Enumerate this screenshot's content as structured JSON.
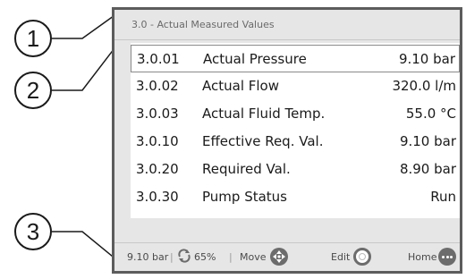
{
  "callouts": [
    "1",
    "2",
    "3"
  ],
  "screen": {
    "title": "3.0 - Actual Measured Values",
    "rows": [
      {
        "id": "3.0.01",
        "label": "Actual Pressure",
        "value": "9.10 bar",
        "selected": true
      },
      {
        "id": "3.0.02",
        "label": "Actual Flow",
        "value": "320.0 l/m",
        "selected": false
      },
      {
        "id": "3.0.03",
        "label": "Actual Fluid Temp.",
        "value": "55.0 °C",
        "selected": false
      },
      {
        "id": "3.0.10",
        "label": "Effective Req. Val.",
        "value": "9.10 bar",
        "selected": false
      },
      {
        "id": "3.0.20",
        "label": "Required Val.",
        "value": "8.90 bar",
        "selected": false
      },
      {
        "id": "3.0.30",
        "label": "Pump Status",
        "value": "Run",
        "selected": false
      }
    ]
  },
  "status_bar": {
    "pressure": "9.10 bar",
    "separator": "|",
    "speed_icon": "rotation-arrows-icon",
    "speed": "65%",
    "move_label": "Move",
    "move_icon": "dpad-icon",
    "edit_label": "Edit",
    "edit_icon": "ring-button-icon",
    "home_label": "Home",
    "home_icon": "dots-button-icon"
  },
  "colors": {
    "frame": "#5c5c5c",
    "panel_bg": "#e6e6e6",
    "list_bg": "#ffffff",
    "icon_grey": "#6c6c6c",
    "text": "#1a1a1a"
  }
}
